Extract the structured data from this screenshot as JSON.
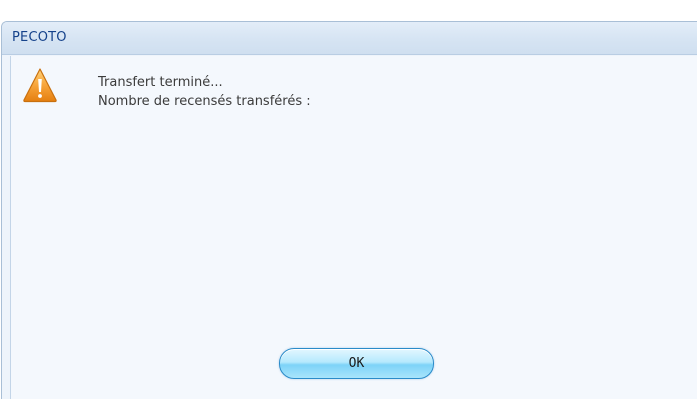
{
  "window": {
    "title": "PECOTO"
  },
  "dialog": {
    "icon": "warning-icon",
    "message_line1": "Transfert terminé...",
    "message_line2": "Nombre de recensés transférés :",
    "ok_label": "OK"
  },
  "colors": {
    "title_text": "#15428b",
    "titlebar_bg": "#d6e4f3",
    "content_bg": "#f4f8fd",
    "button_accent": "#7dd3f8",
    "warning_orange": "#f39c12"
  }
}
